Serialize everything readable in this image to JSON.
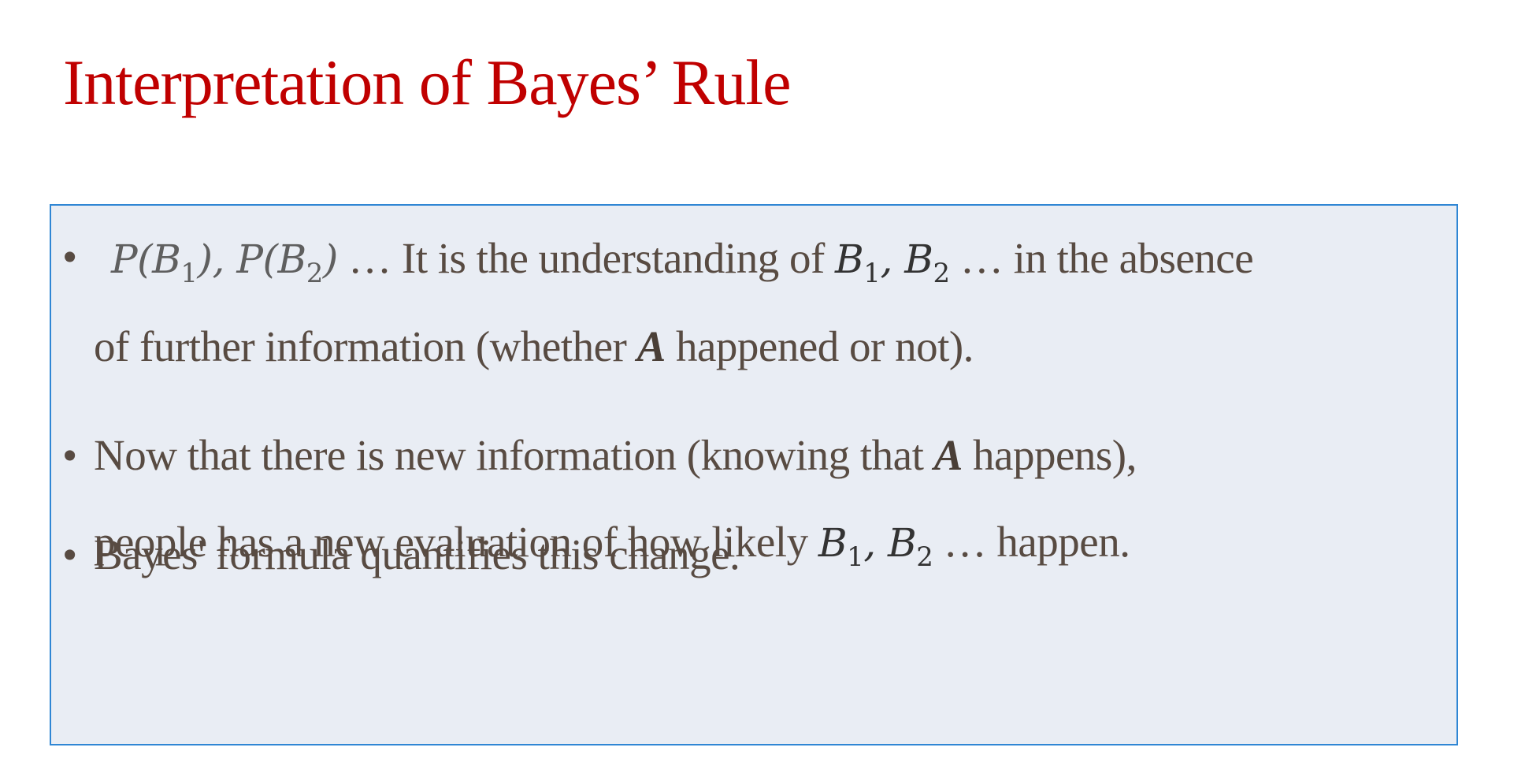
{
  "slide": {
    "title": "Interpretation of Bayes’ Rule",
    "bullets": [
      {
        "line1": {
          "math_prefix": "P(B₁), P(B₂)",
          "text1": " … It is the understanding of ",
          "math_mid": "B₁, B₂",
          "text2": " … in the absence"
        },
        "line2": {
          "text1": "of further information (whether ",
          "emph": "A",
          "text2": " happened or not)."
        }
      },
      {
        "line1": {
          "text1": "Now that there is new information (knowing that ",
          "emph": "A",
          "text2": " happens),"
        },
        "line2": {
          "text1": "people has a new evaluation of how likely ",
          "math_mid": "B₁, B₂",
          "text2": " …  happen."
        }
      },
      {
        "line1": {
          "text1": "Bayes' formula quantifies this change."
        }
      }
    ],
    "colors": {
      "title": "#c00000",
      "text": "#584b42",
      "box_fill": "#e9edf4",
      "box_border": "#2f86d4"
    },
    "bullet_glyph": "•"
  }
}
